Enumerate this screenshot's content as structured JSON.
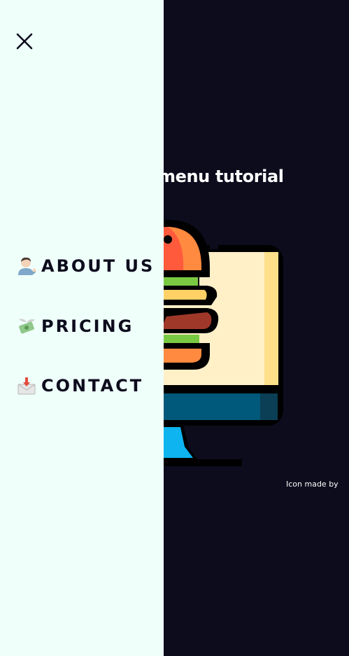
{
  "main": {
    "title": "menu tutorial",
    "credit": "Icon made by"
  },
  "colors": {
    "background": "#0d0c1d",
    "drawer": "#effffa",
    "text_dark": "#0d0c1d",
    "text_light": "#ffffff"
  },
  "drawer": {
    "close_icon": "close-icon",
    "items": [
      {
        "label": "ABOUT US",
        "icon": "person-tipping-hand-icon"
      },
      {
        "label": "PRICING",
        "icon": "money-with-wings-icon"
      },
      {
        "label": "CONTACT",
        "icon": "envelope-with-arrow-icon"
      }
    ]
  }
}
